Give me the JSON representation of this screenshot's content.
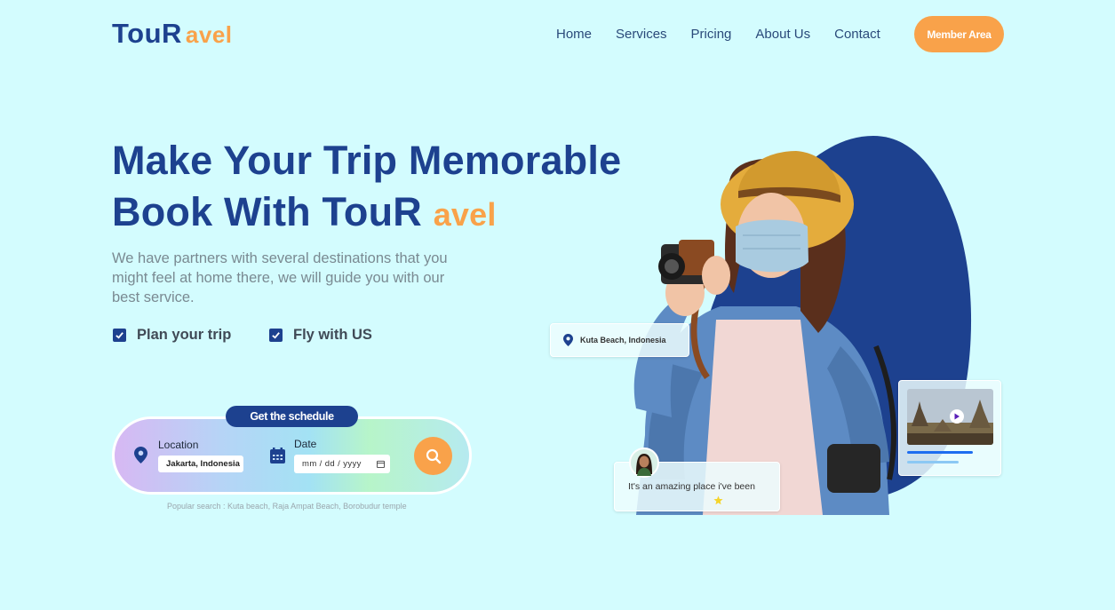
{
  "brand": {
    "name": "TouR",
    "accent": "avel"
  },
  "nav": {
    "items": [
      "Home",
      "Services",
      "Pricing",
      "About Us",
      "Contact"
    ],
    "member_label": "Member Area"
  },
  "hero": {
    "line1": "Make Your Trip Memorable",
    "line2_main": "Book With TouR",
    "line2_accent": "avel",
    "description": "We have partners with several destinations that you might feel at home there, we will guide you with our best service.",
    "checks": [
      "Plan your trip",
      "Fly with US"
    ]
  },
  "search": {
    "schedule_label": "Get the schedule",
    "location_label": "Location",
    "location_value": "Jakarta, Indonesia",
    "date_label": "Date",
    "date_placeholder": "mm / dd / yyyy",
    "popular": "Popular search : Kuta beach, Raja Ampat Beach, Borobudur temple"
  },
  "cards": {
    "location_tag": "Kuta Beach, Indonesia",
    "review_text": "It's an amazing place i've been",
    "review_stars": 1
  },
  "colors": {
    "brand": "#1d418f",
    "accent": "#f9a24a",
    "background": "#d3fcfe"
  }
}
